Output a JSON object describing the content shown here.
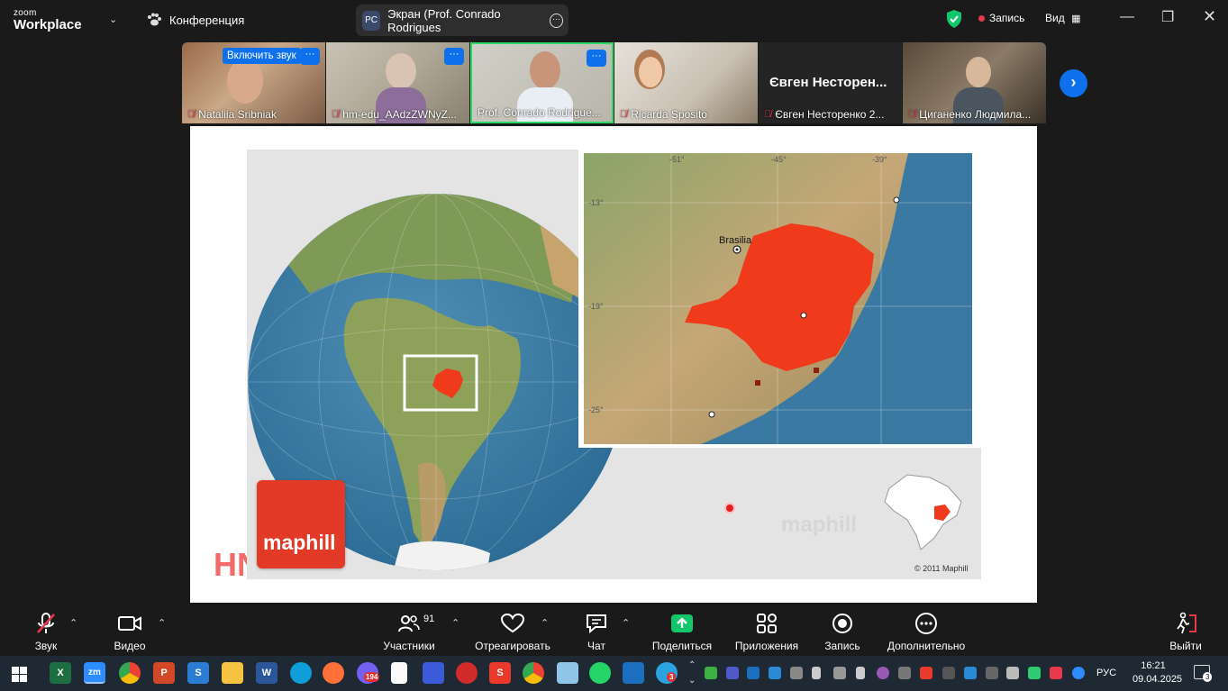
{
  "titlebar": {
    "logo_small": "zoom",
    "logo_big": "Workplace",
    "meeting_label": "Конференция",
    "screen_share": {
      "initials": "PC",
      "label": "Экран (Prof. Conrado Rodrigues"
    },
    "recording_label": "Запись",
    "view_label": "Вид"
  },
  "participants": [
    {
      "name": "Nataliia Sribniak",
      "unmute_label": "Включить звук",
      "muted": true
    },
    {
      "name": "hm-edu_AAdzZWNyZ...",
      "muted": true
    },
    {
      "name": "Prof. Conrado Rodrigue...",
      "muted": false,
      "active_speaker": true
    },
    {
      "name": "Ricarda Sposito",
      "muted": true
    },
    {
      "name": "Євген Несторенко 2...",
      "display_name": "Євген  Несторен...",
      "muted": true
    },
    {
      "name": "Циганенко Людмила...",
      "muted": true
    }
  ],
  "slide": {
    "map_labels": {
      "city": "Brasilia",
      "lon_labels": [
        "-51°",
        "-45°",
        "-39°"
      ],
      "lat_labels": [
        "-13°",
        "-19°",
        "-25°"
      ],
      "brand": "maphill",
      "watermark": "maphill",
      "copyright": "© 2011 Maphill",
      "corner_text": "HN"
    }
  },
  "toolbar": {
    "audio": "Звук",
    "video": "Видео",
    "participants": "Участники",
    "participants_count": "91",
    "react": "Отреагировать",
    "chat": "Чат",
    "share": "Поделиться",
    "apps": "Приложения",
    "record": "Запись",
    "more": "Дополнительно",
    "leave": "Выйти"
  },
  "taskbar": {
    "viber_badge": "194",
    "telegram_badge": "3",
    "lang": "РУС",
    "time": "16:21",
    "date": "09.04.2025",
    "notif_count": "3"
  },
  "colors": {
    "accent_blue": "#0e71eb",
    "record_red": "#e8394b",
    "region_red": "#ef3a1c",
    "share_green": "#12c66c",
    "speaker_green": "#2bd96b"
  }
}
